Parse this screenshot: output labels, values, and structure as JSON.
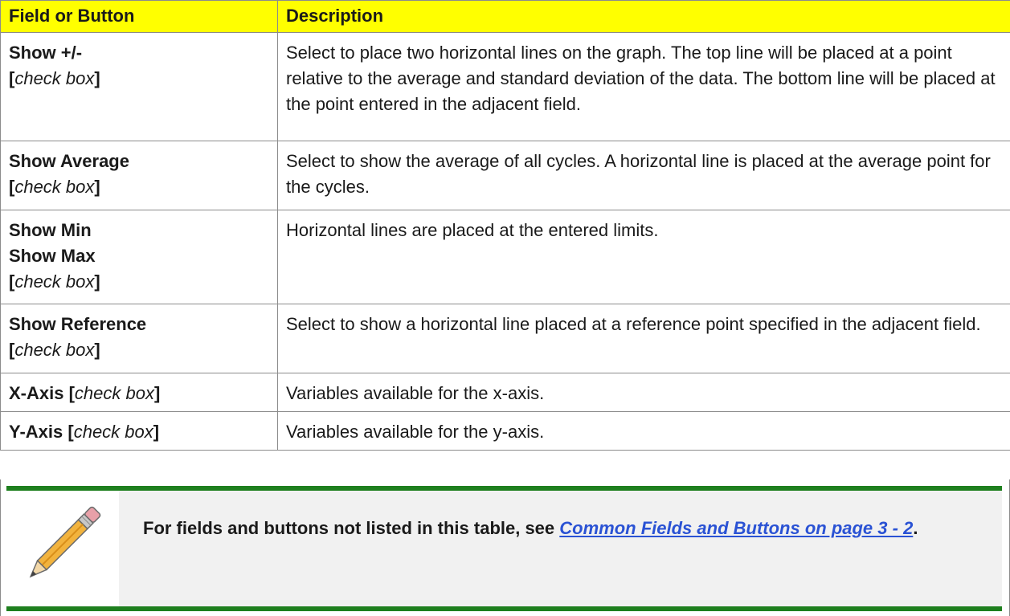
{
  "table": {
    "headers": [
      "Field or Button",
      "Description"
    ],
    "rows": [
      {
        "field_lines": [
          {
            "bold": "Show +/-"
          },
          {
            "bold_open": "[",
            "italic": "check box",
            "bold_close": "]"
          }
        ],
        "description": "Select to place two horizontal lines on the graph. The top line will be placed at a point relative to the average and standard deviation of the data. The bottom line will be placed at the point entered in the adjacent field."
      },
      {
        "field_lines": [
          {
            "bold": "Show Average"
          },
          {
            "bold_open": "[",
            "italic": "check box",
            "bold_close": "]"
          }
        ],
        "description": "Select to show the average of all cycles. A horizontal line is placed at the average point for the cycles."
      },
      {
        "field_lines": [
          {
            "bold": "Show Min"
          },
          {
            "bold": "Show Max"
          },
          {
            "bold_open": "[",
            "italic": "check box",
            "bold_close": "]"
          }
        ],
        "description": "Horizontal lines are placed at the entered limits."
      },
      {
        "field_lines": [
          {
            "bold": "Show Reference"
          },
          {
            "bold_open": "[",
            "italic": "check box",
            "bold_close": "]"
          }
        ],
        "description": "Select to show a horizontal line placed at a reference point specified in the adjacent field."
      },
      {
        "field_lines": [
          {
            "bold_open": "X-Axis [",
            "italic": "check box",
            "bold_close": "]"
          }
        ],
        "description": "Variables available for the x-axis."
      },
      {
        "field_lines": [
          {
            "bold_open": "Y-Axis [",
            "italic": "check box",
            "bold_close": "]"
          }
        ],
        "description": "Variables available for the y-axis."
      }
    ]
  },
  "note": {
    "icon": "pencil-icon",
    "text_before": "For fields and buttons not listed in this table, see ",
    "link_text": "Common Fields and Buttons on page 3 - 2",
    "text_after": "."
  },
  "colors": {
    "header_bg": "#ffff00",
    "note_bar": "#1e7f1e",
    "note_bg": "#f1f1f1",
    "link": "#2a52d4",
    "border": "#8c8c8c"
  }
}
